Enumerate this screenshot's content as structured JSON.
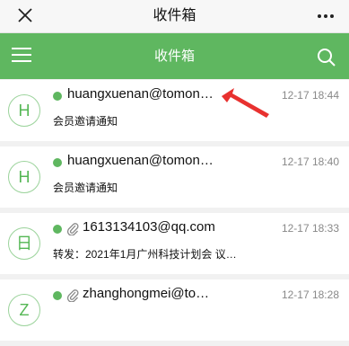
{
  "header": {
    "title": "收件箱"
  },
  "toolbar": {
    "title": "收件箱"
  },
  "messages": [
    {
      "avatar": "H",
      "sender": "huangxuenan@tomon…",
      "date": "12-17 18:44",
      "subject": "会员邀请通知",
      "unread": true,
      "attachment": false
    },
    {
      "avatar": "H",
      "sender": "huangxuenan@tomon…",
      "date": "12-17 18:40",
      "subject": "会员邀请通知",
      "unread": true,
      "attachment": false
    },
    {
      "avatar": "日",
      "sender": "1613134103@qq.com",
      "date": "12-17 18:33",
      "subject": "转发：2021年1月广州科技计划会 议…",
      "unread": true,
      "attachment": true
    },
    {
      "avatar": "Z",
      "sender": "zhanghongmei@to…",
      "date": "12-17 18:28",
      "subject": "",
      "unread": true,
      "attachment": true
    }
  ],
  "colors": {
    "accent": "#5fb760",
    "annotation": "#e8312f"
  }
}
